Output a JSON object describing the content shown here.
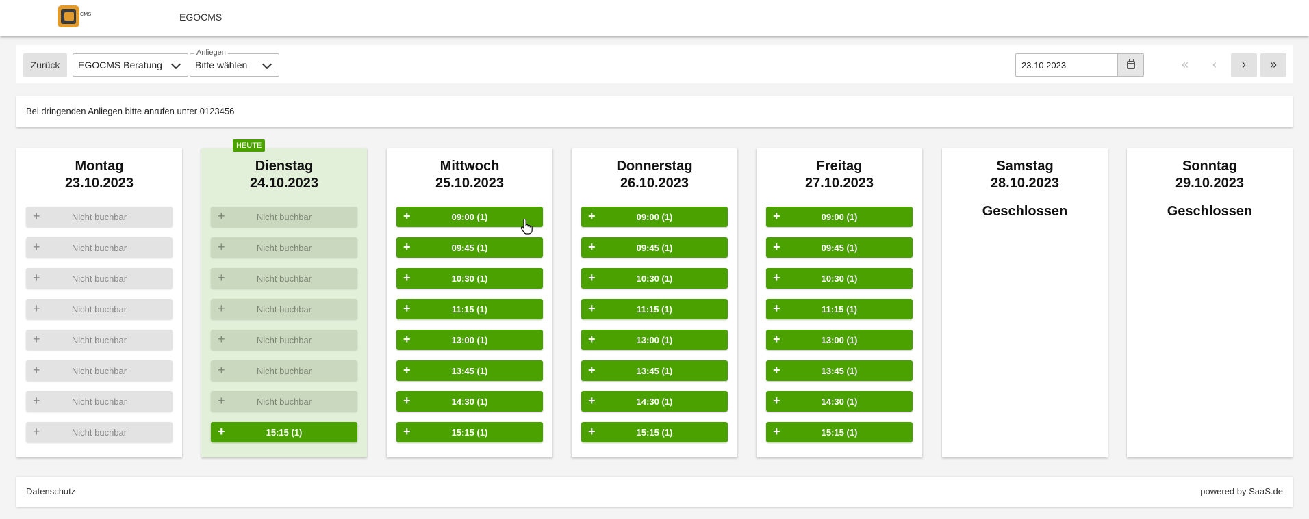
{
  "header": {
    "app_name": "EGOCMS",
    "logo_text": "CMS"
  },
  "toolbar": {
    "back_label": "Zurück",
    "organisation": {
      "value": "EGOCMS Beratung"
    },
    "concern": {
      "label": "Anliegen",
      "value": "Bitte wählen"
    },
    "date": {
      "value": "23.10.2023"
    },
    "nav": {
      "first": "«",
      "prev": "‹",
      "next": "›",
      "last": "»"
    }
  },
  "notice": "Bei dringenden Anliegen bitte anrufen unter 0123456",
  "today_badge": "HEUTE",
  "colors": {
    "available": "#4aa100",
    "unavailable": "#e3e3e3",
    "today_bg": "#e2f0d9"
  },
  "days": [
    {
      "name": "Montag",
      "date": "23.10.2023",
      "slots": [
        {
          "label": "Nicht buchbar",
          "available": false
        },
        {
          "label": "Nicht buchbar",
          "available": false
        },
        {
          "label": "Nicht buchbar",
          "available": false
        },
        {
          "label": "Nicht buchbar",
          "available": false
        },
        {
          "label": "Nicht buchbar",
          "available": false
        },
        {
          "label": "Nicht buchbar",
          "available": false
        },
        {
          "label": "Nicht buchbar",
          "available": false
        },
        {
          "label": "Nicht buchbar",
          "available": false
        }
      ]
    },
    {
      "name": "Dienstag",
      "date": "24.10.2023",
      "today": true,
      "slots": [
        {
          "label": "Nicht buchbar",
          "available": false
        },
        {
          "label": "Nicht buchbar",
          "available": false
        },
        {
          "label": "Nicht buchbar",
          "available": false
        },
        {
          "label": "Nicht buchbar",
          "available": false
        },
        {
          "label": "Nicht buchbar",
          "available": false
        },
        {
          "label": "Nicht buchbar",
          "available": false
        },
        {
          "label": "Nicht buchbar",
          "available": false
        },
        {
          "label": "15:15 (1)",
          "available": true
        }
      ]
    },
    {
      "name": "Mittwoch",
      "date": "25.10.2023",
      "slots": [
        {
          "label": "09:00 (1)",
          "available": true
        },
        {
          "label": "09:45 (1)",
          "available": true
        },
        {
          "label": "10:30 (1)",
          "available": true
        },
        {
          "label": "11:15 (1)",
          "available": true
        },
        {
          "label": "13:00 (1)",
          "available": true
        },
        {
          "label": "13:45 (1)",
          "available": true
        },
        {
          "label": "14:30 (1)",
          "available": true
        },
        {
          "label": "15:15 (1)",
          "available": true
        }
      ]
    },
    {
      "name": "Donnerstag",
      "date": "26.10.2023",
      "slots": [
        {
          "label": "09:00 (1)",
          "available": true
        },
        {
          "label": "09:45 (1)",
          "available": true
        },
        {
          "label": "10:30 (1)",
          "available": true
        },
        {
          "label": "11:15 (1)",
          "available": true
        },
        {
          "label": "13:00 (1)",
          "available": true
        },
        {
          "label": "13:45 (1)",
          "available": true
        },
        {
          "label": "14:30 (1)",
          "available": true
        },
        {
          "label": "15:15 (1)",
          "available": true
        }
      ]
    },
    {
      "name": "Freitag",
      "date": "27.10.2023",
      "slots": [
        {
          "label": "09:00 (1)",
          "available": true
        },
        {
          "label": "09:45 (1)",
          "available": true
        },
        {
          "label": "10:30 (1)",
          "available": true
        },
        {
          "label": "11:15 (1)",
          "available": true
        },
        {
          "label": "13:00 (1)",
          "available": true
        },
        {
          "label": "13:45 (1)",
          "available": true
        },
        {
          "label": "14:30 (1)",
          "available": true
        },
        {
          "label": "15:15 (1)",
          "available": true
        }
      ]
    },
    {
      "name": "Samstag",
      "date": "28.10.2023",
      "closed": "Geschlossen",
      "slots": []
    },
    {
      "name": "Sonntag",
      "date": "29.10.2023",
      "closed": "Geschlossen",
      "slots": []
    }
  ],
  "slot_plus": "+",
  "footer": {
    "privacy": "Datenschutz",
    "powered": "powered by SaaS.de"
  }
}
